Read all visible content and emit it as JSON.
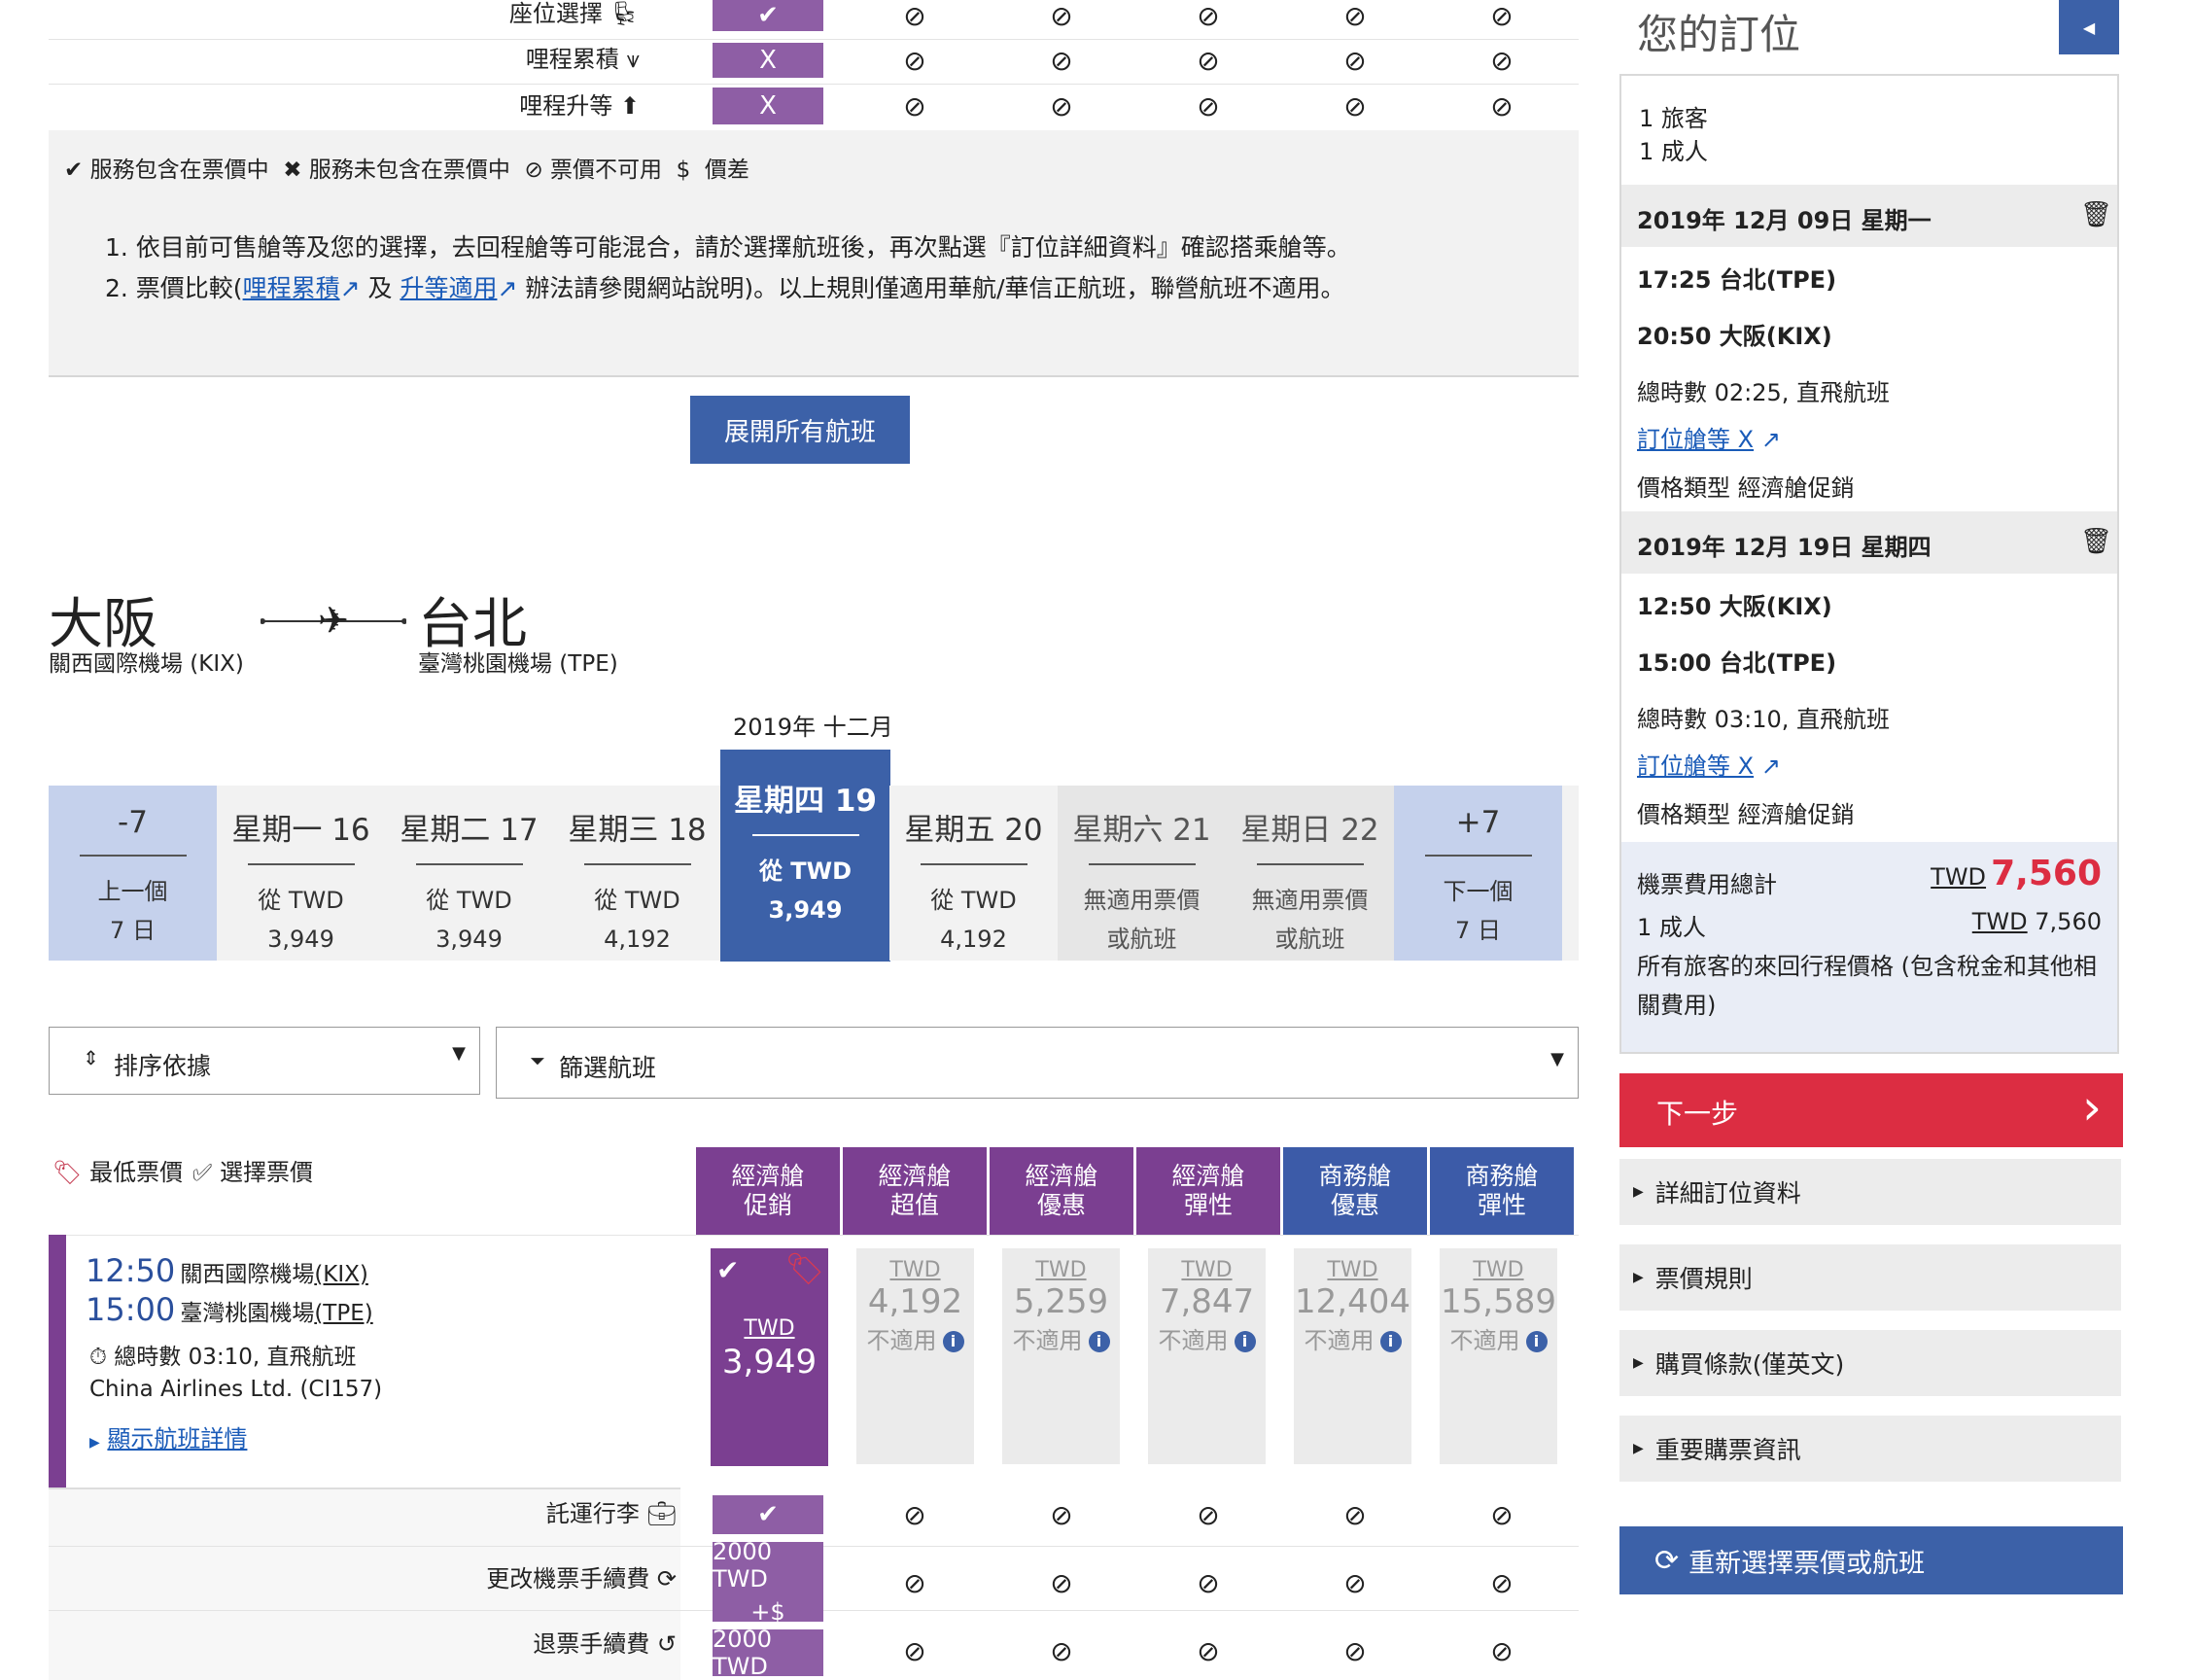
{
  "benefits_top": {
    "rows": [
      {
        "label": "座位選擇",
        "icon": "seat-icon",
        "first": "✔"
      },
      {
        "label": "哩程累積",
        "icon": "mileage-icon",
        "first": "X"
      },
      {
        "label": "哩程升等",
        "icon": "upgrade-icon",
        "first": "X"
      }
    ],
    "na_symbol": "⊘"
  },
  "legend": {
    "included": "服務包含在票價中",
    "excluded": "服務未包含在票價中",
    "unavailable": "票價不可用",
    "diff": "價差",
    "dollar": "$"
  },
  "notes": {
    "n1": "1. 依目前可售艙等及您的選擇，去回程艙等可能混合，請於選擇航班後，再次點選『訂位詳細資料』確認搭乘艙等。",
    "n2_pre": "2. 票價比較(",
    "n2_link1": "哩程累積",
    "n2_mid": " 及 ",
    "n2_link2": "升等適用",
    "n2_post": " 辦法請參閱網站說明)。以上規則僅適用華航/華信正航班，聯營航班不適用。"
  },
  "expand_btn": "展開所有航班",
  "route": {
    "from_city": "大阪",
    "from_airport": "關西國際機場 (KIX)",
    "to_city": "台北",
    "to_airport": "臺灣桃園機場 (TPE)"
  },
  "month_label": "2019年 十二月",
  "dates": [
    {
      "d": "-7",
      "s1": "上一個",
      "s2": "7 日",
      "kind": "nav"
    },
    {
      "d": "星期一 16",
      "s1": "從 TWD",
      "s2": "3,949",
      "kind": "day"
    },
    {
      "d": "星期二 17",
      "s1": "從 TWD",
      "s2": "3,949",
      "kind": "day"
    },
    {
      "d": "星期三 18",
      "s1": "從 TWD",
      "s2": "4,192",
      "kind": "day"
    },
    {
      "d": "星期四 19",
      "s1": "從 TWD",
      "s2": "3,949",
      "kind": "selected"
    },
    {
      "d": "星期五 20",
      "s1": "從 TWD",
      "s2": "4,192",
      "kind": "day"
    },
    {
      "d": "星期六 21",
      "s1": "無適用票價",
      "s2": "或航班",
      "kind": "none"
    },
    {
      "d": "星期日 22",
      "s1": "無適用票價",
      "s2": "或航班",
      "kind": "none"
    },
    {
      "d": "+7",
      "s1": "下一個",
      "s2": "7 日",
      "kind": "nav"
    }
  ],
  "sort_label": "排序依據",
  "filter_label": "篩選航班",
  "legend2": {
    "lowest": "最低票價",
    "selected": "選擇票價"
  },
  "fare_headers": [
    {
      "l1": "經濟艙",
      "l2": "促銷",
      "color": "#7b3f91"
    },
    {
      "l1": "經濟艙",
      "l2": "超值",
      "color": "#7b3f91"
    },
    {
      "l1": "經濟艙",
      "l2": "優惠",
      "color": "#7b3f91"
    },
    {
      "l1": "經濟艙",
      "l2": "彈性",
      "color": "#7b3f91"
    },
    {
      "l1": "商務艙",
      "l2": "優惠",
      "color": "#3c5ba8"
    },
    {
      "l1": "商務艙",
      "l2": "彈性",
      "color": "#3c5ba8"
    }
  ],
  "flight": {
    "dep_time": "12:50",
    "dep_airport": "關西國際機場",
    "dep_code": "(KIX)",
    "arr_time": "15:00",
    "arr_airport": "臺灣桃園機場",
    "arr_code": "(TPE)",
    "duration": "總時數 03:10, 直飛航班",
    "carrier": "China Airlines Ltd. (CI157)",
    "details_link": "顯示航班詳情"
  },
  "fares": [
    {
      "cur": "TWD",
      "amt": "3,949",
      "na": ""
    },
    {
      "cur": "TWD",
      "amt": "4,192",
      "na": "不適用"
    },
    {
      "cur": "TWD",
      "amt": "5,259",
      "na": "不適用"
    },
    {
      "cur": "TWD",
      "amt": "7,847",
      "na": "不適用"
    },
    {
      "cur": "TWD",
      "amt": "12,404",
      "na": "不適用"
    },
    {
      "cur": "TWD",
      "amt": "15,589",
      "na": "不適用"
    }
  ],
  "benefits_bottom": [
    {
      "label": "託運行李",
      "first1": "✔",
      "first2": ""
    },
    {
      "label": "更改機票手續費",
      "first1": "2000 TWD",
      "first2": "+$"
    },
    {
      "label": "退票手續費",
      "first1": "2000 TWD",
      "first2": ""
    }
  ],
  "booking": {
    "title": "您的訂位",
    "travellers": "1 旅客",
    "adults": "1 成人",
    "leg1": {
      "date": "2019年 12月 09日 星期一",
      "dep": "17:25 台北(TPE)",
      "arr": "20:50 大阪(KIX)",
      "duration": "總時數 02:25, 直飛航班",
      "class_link": "訂位艙等 X",
      "fare_type": "價格類型 經濟艙促銷"
    },
    "leg2": {
      "date": "2019年 12月 19日 星期四",
      "dep": "12:50 大阪(KIX)",
      "arr": "15:00 台北(TPE)",
      "duration": "總時數 03:10, 直飛航班",
      "class_link": "訂位艙等 X",
      "fare_type": "價格類型 經濟艙促銷"
    },
    "total_label": "機票費用總計",
    "total_cur": "TWD",
    "total_amt": "7,560",
    "adult_label": "1 成人",
    "adult_cur": "TWD",
    "adult_amt": "7,560",
    "note": "所有旅客的來回行程價格 (包含稅金和其他相關費用)",
    "next": "下一步",
    "acc": [
      "詳細訂位資料",
      "票價規則",
      "購買條款(僅英文)",
      "重要購票資訊"
    ],
    "reselect": "重新選擇票價或航班"
  },
  "colors": {
    "purple": "#7b3f91",
    "blue": "#3c61a8",
    "red": "#dc2d42",
    "lightblue": "#c5d1ec"
  }
}
